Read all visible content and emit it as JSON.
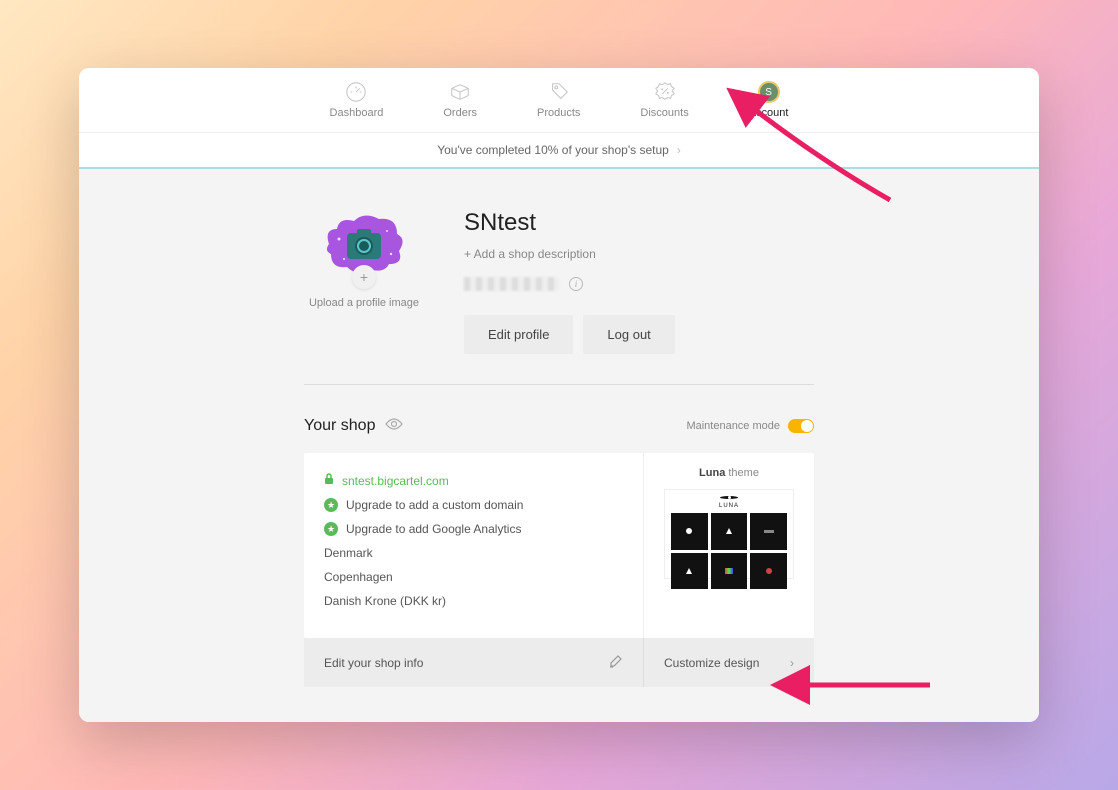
{
  "nav": {
    "items": [
      {
        "label": "Dashboard"
      },
      {
        "label": "Orders"
      },
      {
        "label": "Products"
      },
      {
        "label": "Discounts"
      },
      {
        "label": "Account",
        "active": true,
        "avatar_initial": "S"
      }
    ]
  },
  "progress_banner": "You've completed 10% of your shop's setup",
  "profile": {
    "upload_label": "Upload a profile image",
    "shop_name": "SNtest",
    "add_description": "+ Add a shop description",
    "buttons": {
      "edit": "Edit profile",
      "logout": "Log out"
    }
  },
  "shop": {
    "heading": "Your shop",
    "maintenance_label": "Maintenance mode",
    "maintenance_on": true,
    "url": "sntest.bigcartel.com",
    "upgrade_domain": "Upgrade to add a custom domain",
    "upgrade_analytics": "Upgrade to add Google Analytics",
    "country": "Denmark",
    "city": "Copenhagen",
    "currency": "Danish Krone (DKK kr)",
    "theme_name": "Luna",
    "theme_suffix": "theme",
    "footer_edit": "Edit your shop info",
    "footer_customize": "Customize design"
  }
}
